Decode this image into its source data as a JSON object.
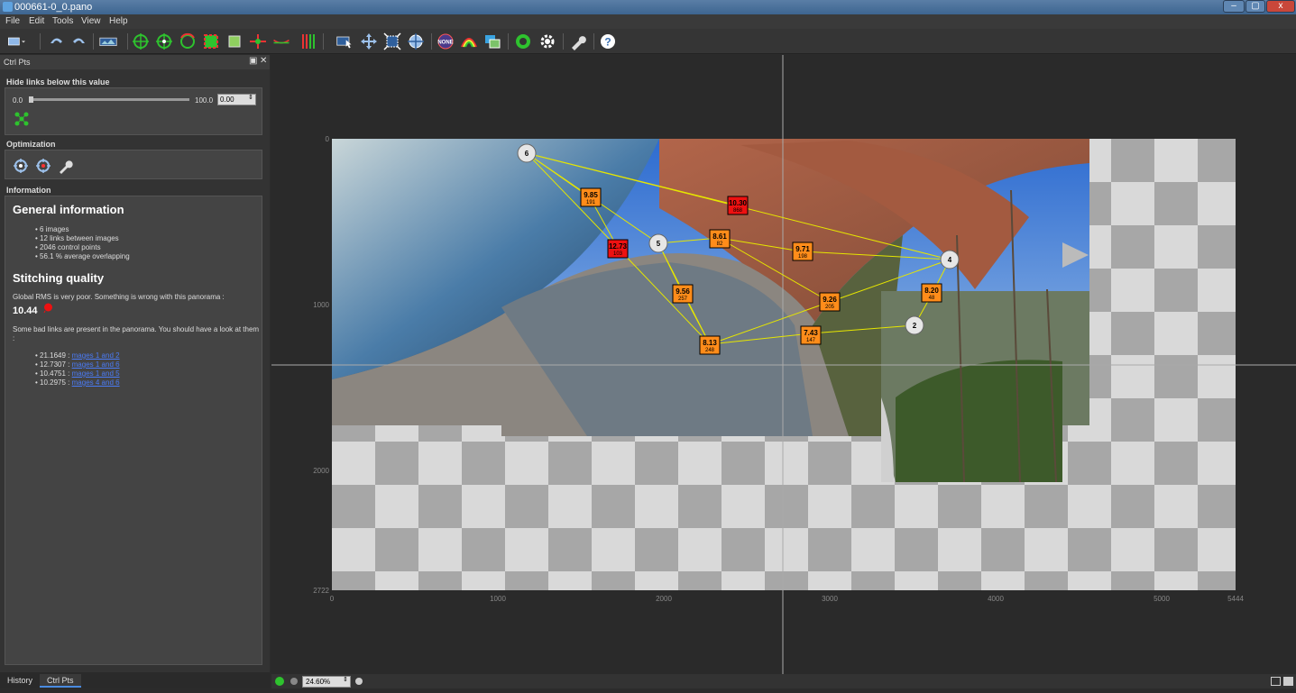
{
  "window": {
    "title": "000661-0_0.pano",
    "minimize": "–",
    "maximize": "▢",
    "close": "x"
  },
  "menu": [
    "File",
    "Edit",
    "Tools",
    "View",
    "Help"
  ],
  "toolbar": {
    "icons": [
      "project-icon",
      "undo-icon",
      "redo-icon",
      "panorama-view-icon",
      "add-control-points-icon",
      "center-icon",
      "rotate-icon",
      "crop-icon",
      "fit-icon",
      "straighten-icon",
      "horizon-icon",
      "vertical-lines-icon",
      "select-icon",
      "move-drag-icon",
      "fit-frame-icon",
      "identify-icon",
      "none-icon",
      "colour-icon",
      "overlap-icon",
      "preview-icon",
      "settings-icon",
      "tools-icon",
      "help-icon"
    ]
  },
  "panel": {
    "title": "Ctrl Pts",
    "hide_links": {
      "title": "Hide links below this value",
      "min_label": "0.0",
      "max_label": "100.0",
      "value": "0.00"
    },
    "optimization": {
      "title": "Optimization"
    },
    "information": {
      "title": "Information",
      "general_heading": "General information",
      "stats": [
        "6 images",
        "12 links between images",
        "2046 control points",
        "56.1 % average overlapping"
      ],
      "quality_heading": "Stitching quality",
      "rms_text": "Global RMS is very poor. Something is wrong with this panorama :",
      "rms_value": "10.44",
      "bad_links_text": "Some bad links are present in the panorama. You should have a look at them :",
      "bad_links": [
        {
          "value": "21.1649 :",
          "link": "mages 1 and 2"
        },
        {
          "value": "12.7307 :",
          "link": "mages 1 and 6"
        },
        {
          "value": "10.4751 :",
          "link": "mages 1 and 5"
        },
        {
          "value": "10.2975 :",
          "link": "mages 4 and 6"
        }
      ]
    }
  },
  "bottom_tabs": [
    "History",
    "Ctrl Pts"
  ],
  "canvas": {
    "x_ticks": [
      "0",
      "1000",
      "2000",
      "3000",
      "4000",
      "5000",
      "5444"
    ],
    "y_ticks": [
      "0",
      "1000",
      "2000",
      "2722"
    ],
    "nodes": [
      "6",
      "5",
      "4",
      "2"
    ],
    "links": [
      {
        "value": "9.85",
        "count": "191",
        "bad": false
      },
      {
        "value": "10.30",
        "count": "868",
        "bad": true
      },
      {
        "value": "12.73",
        "count": "103",
        "bad": true
      },
      {
        "value": "8.61",
        "count": "82",
        "bad": false
      },
      {
        "value": "9.71",
        "count": "198",
        "bad": false
      },
      {
        "value": "9.56",
        "count": "257",
        "bad": false
      },
      {
        "value": "9.26",
        "count": "205",
        "bad": false
      },
      {
        "value": "8.20",
        "count": "48",
        "bad": false
      },
      {
        "value": "7.43",
        "count": "147",
        "bad": false
      },
      {
        "value": "8.13",
        "count": "248",
        "bad": false
      }
    ]
  },
  "status": {
    "zoom": "24.60%"
  },
  "colors": {
    "good_link": "#ff8c1a",
    "bad_link": "#ee1111",
    "link_line": "#e6e600"
  }
}
